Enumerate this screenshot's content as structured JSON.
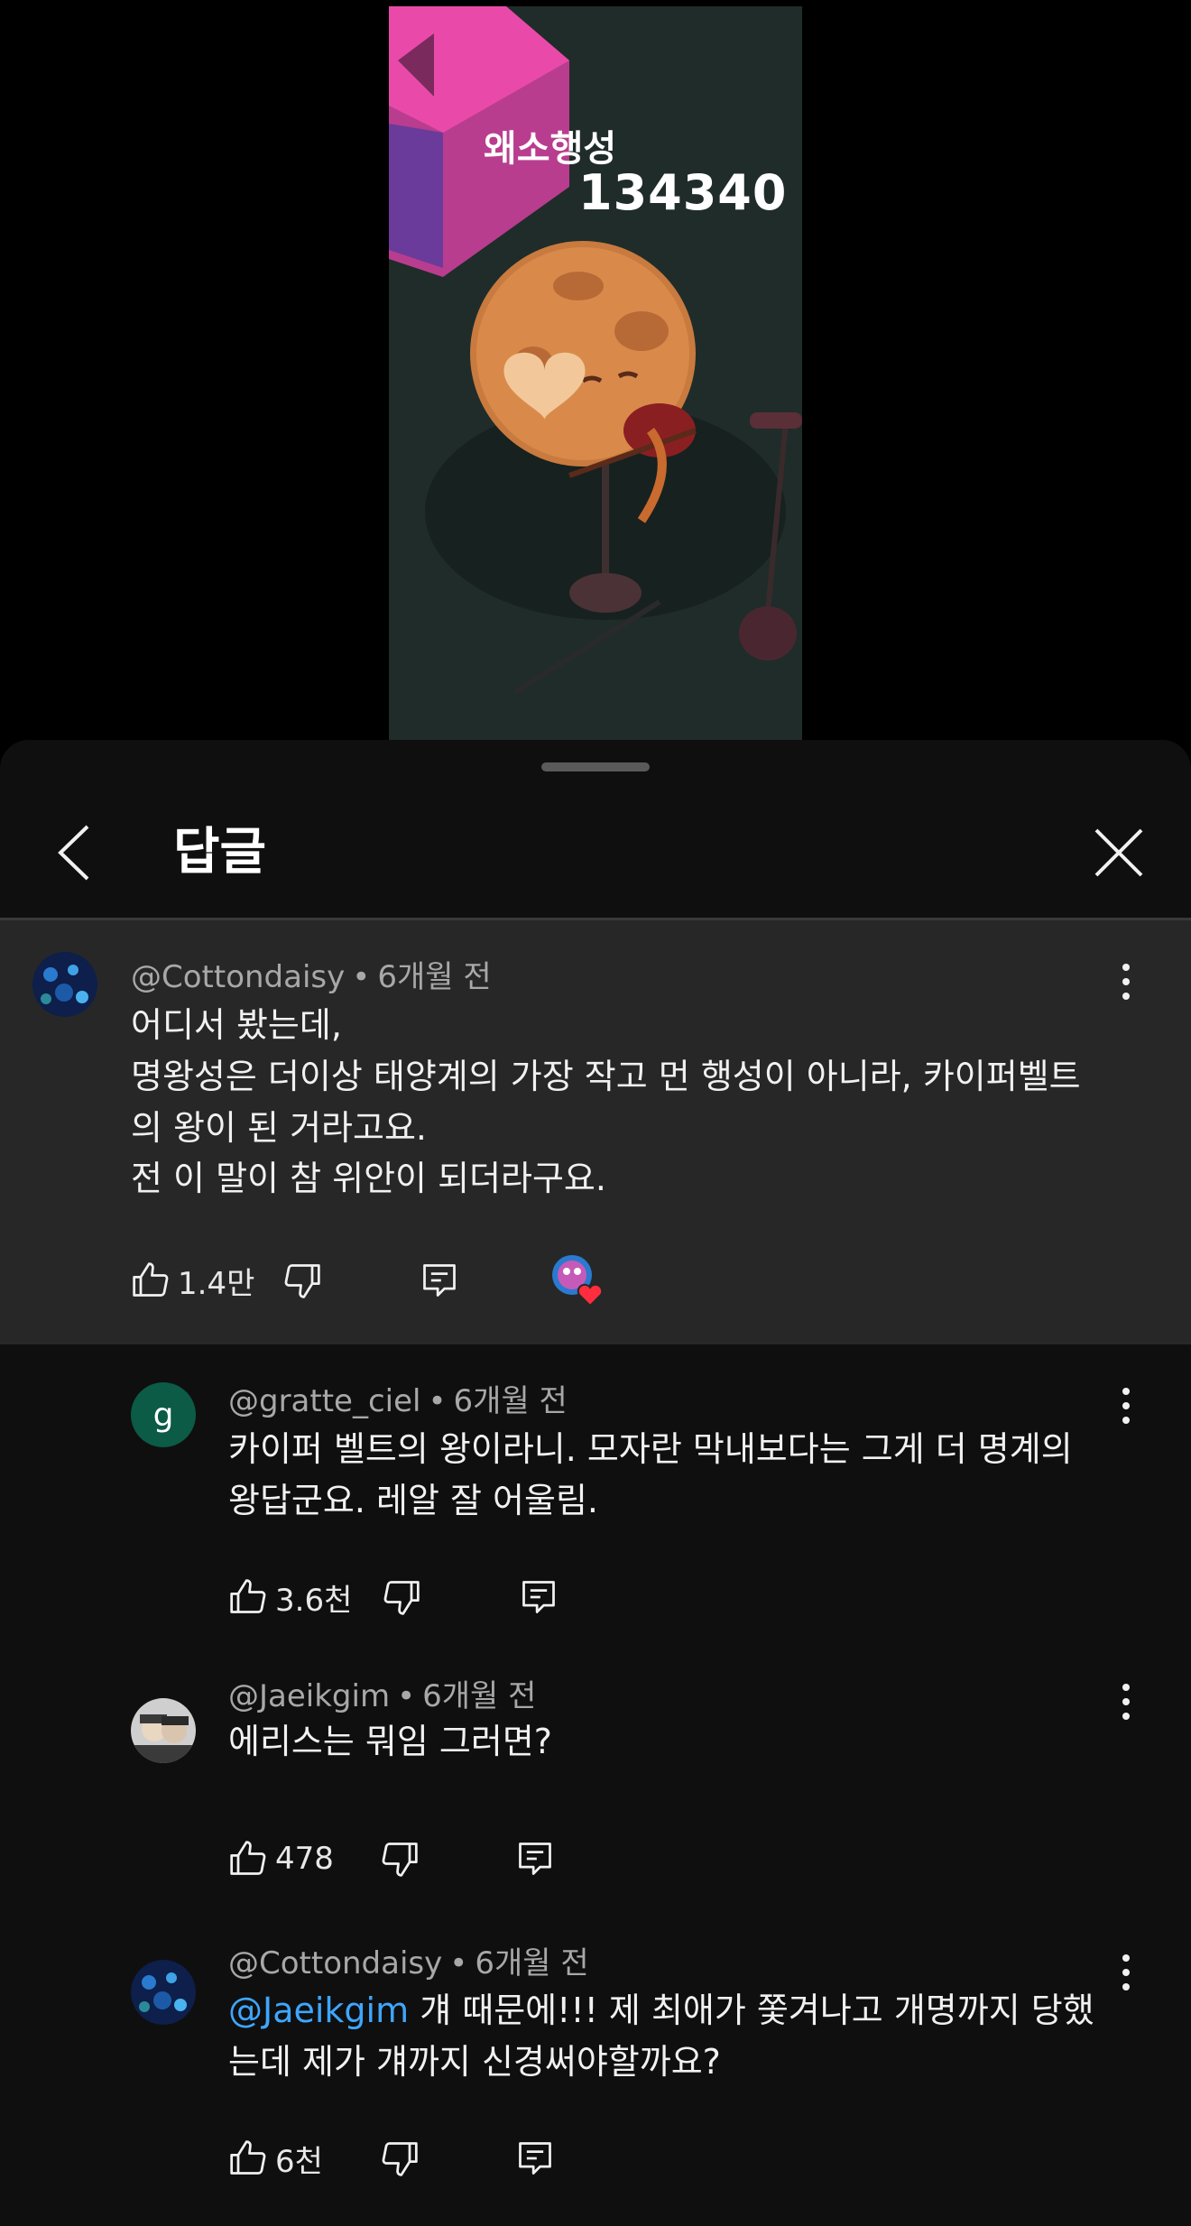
{
  "video": {
    "overlay_title": "왜소행성",
    "overlay_number": "134340"
  },
  "header": {
    "title": "답글"
  },
  "parent_comment": {
    "author": "@Cottondaisy",
    "time": "6개월 전",
    "lines": [
      "어디서 봤는데,",
      "명왕성은 더이상 태양계의 가장 작고 먼 행성이 아니라, 카이퍼벨트",
      "의 왕이 된 거라고요.",
      "전 이 말이 참 위안이 되더라구요."
    ],
    "likes": "1.4만"
  },
  "replies": [
    {
      "author": "@gratte_ciel",
      "time": "6개월 전",
      "avatar_letter": "g",
      "lines": [
        "카이퍼 벨트의 왕이라니. 모자란 막내보다는 그게 더 명계의",
        "왕답군요. 레알 잘 어울림."
      ],
      "likes": "3.6천"
    },
    {
      "author": "@Jaeikgim",
      "time": "6개월 전",
      "lines": [
        "에리스는 뭐임 그러면?"
      ],
      "likes": "478"
    },
    {
      "author": "@Cottondaisy",
      "time": "6개월 전",
      "mention": "@Jaeikgim",
      "line1_rest": " 걔 때문에!!! 제 최애가 쫓겨나고 개명까지 당했",
      "line2": "는데 제가 걔까지 신경써야할까요?",
      "likes": "6천"
    }
  ],
  "colors": {
    "background": "#0f0f0f",
    "highlight": "#272727",
    "mention": "#3ea6ff",
    "avatar_g": "#0b5b46"
  }
}
